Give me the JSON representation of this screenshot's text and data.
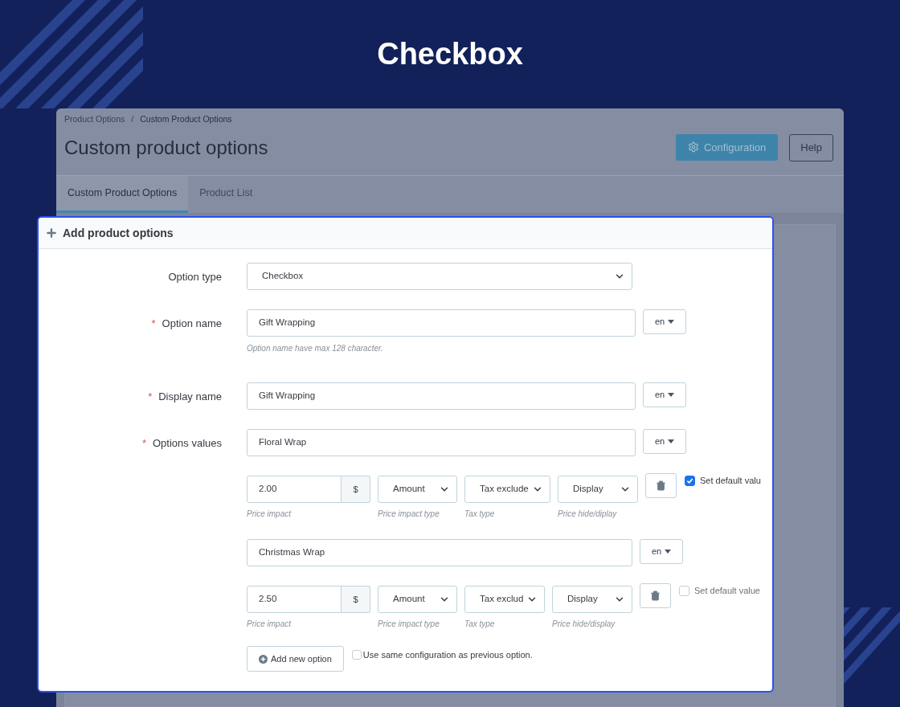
{
  "heading": "Checkbox",
  "breadcrumb": {
    "items": [
      "Product Options",
      "Custom Product Options"
    ],
    "separator": "/"
  },
  "page_title": "Custom product options",
  "buttons": [
    {
      "label": "Configuration",
      "kind": "primary"
    },
    {
      "label": "Help",
      "kind": "default"
    }
  ],
  "tabs": [
    {
      "label": "Custom Product Options",
      "selected": true
    },
    {
      "label": "Product List",
      "selected": false
    }
  ],
  "panel": {
    "title": "Add product options",
    "required_mark": "*",
    "fields": [
      {
        "label": "Option type",
        "required": false,
        "kind": "select",
        "value": "Checkbox"
      },
      {
        "label": "Option name",
        "required": true,
        "kind": "text",
        "value": "Gift Wrapping",
        "language": "en",
        "help": "Option name have max 128 character."
      },
      {
        "label": "Display name",
        "required": true,
        "kind": "text",
        "value": "Gift Wrapping",
        "language": "en"
      }
    ],
    "options_values": {
      "label": "Options values",
      "required": true,
      "items": [
        {
          "name": "Floral Wrap",
          "language": "en",
          "price": "2.00",
          "currency": "$",
          "impact_type": "Amount",
          "tax_type": "Tax exclude",
          "visibility": "Display",
          "default_label": "Set default valu",
          "is_default": true,
          "hints": [
            "Price impact",
            "Price impact type",
            "Tax type",
            "Price hide/diplay"
          ]
        },
        {
          "name": "Christmas Wrap",
          "language": "en",
          "price": "2.50",
          "currency": "$",
          "impact_type": "Amount",
          "tax_type": "Tax exclud",
          "visibility": "Display",
          "default_label": "Set default value",
          "is_default": false,
          "hints": [
            "Price impact",
            "Price impact type",
            "Tax type",
            "Price hide/display"
          ]
        }
      ]
    },
    "add_button": "Add new option",
    "same_config": {
      "label": "Use same configuration as previous option.",
      "checked": false
    }
  }
}
